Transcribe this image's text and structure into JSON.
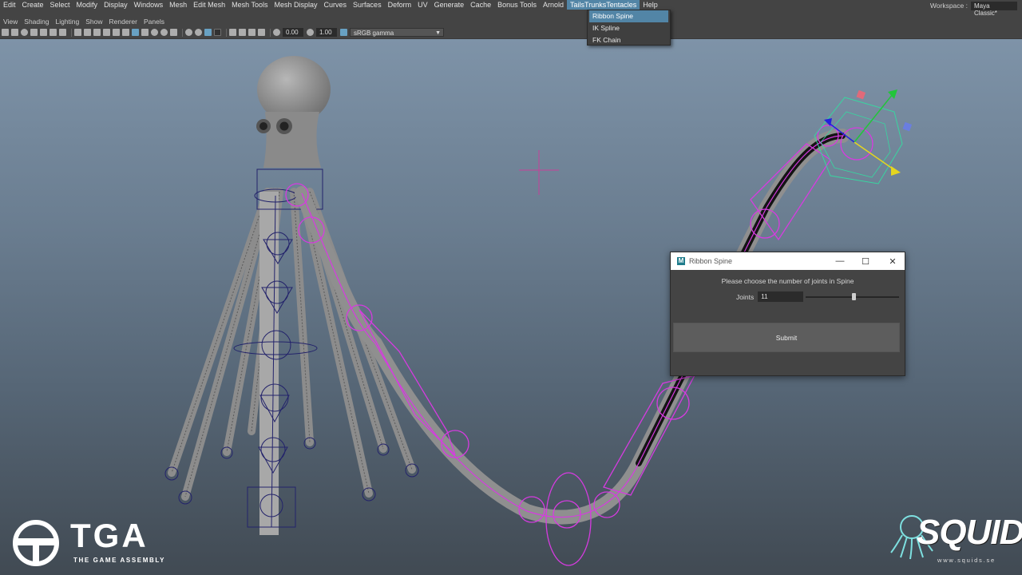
{
  "menubar": {
    "items": [
      "Edit",
      "Create",
      "Select",
      "Modify",
      "Display",
      "Windows",
      "Mesh",
      "Edit Mesh",
      "Mesh Tools",
      "Mesh Display",
      "Curves",
      "Surfaces",
      "Deform",
      "UV",
      "Generate",
      "Cache",
      "Bonus Tools",
      "Arnold",
      "TailsTrunksTentacles",
      "Help"
    ],
    "active": "TailsTrunksTentacles"
  },
  "workspace": {
    "label": "Workspace :",
    "value": "Maya Classic*"
  },
  "panel_menu": [
    "View",
    "Shading",
    "Lighting",
    "Show",
    "Renderer",
    "Panels"
  ],
  "toolbar": {
    "field1": "0.00",
    "field2": "1.00",
    "color_space": "sRGB gamma"
  },
  "dropdown": {
    "items": [
      "Ribbon Spine",
      "IK Spline",
      "FK Chain"
    ],
    "highlighted": "Ribbon Spine"
  },
  "dialog": {
    "title": "Ribbon Spine",
    "logo_letter": "M",
    "minimize": "—",
    "maximize": "☐",
    "close": "✕",
    "prompt": "Please choose the number of joints in Spine",
    "joints_label": "Joints",
    "joints_value": "11",
    "slider_fraction": 0.52,
    "submit_label": "Submit"
  },
  "watermarks": {
    "tga_word": "TGA",
    "tga_sub": "THE GAME ASSEMBLY",
    "squids_word": "SQUIDS",
    "squids_url": "www.squids.se"
  },
  "colors": {
    "menu_highlight": "#5285a6",
    "wire_magenta": "#d63be0",
    "mesh_grey": "#9a9a9a",
    "joint_navy": "#23236b"
  }
}
